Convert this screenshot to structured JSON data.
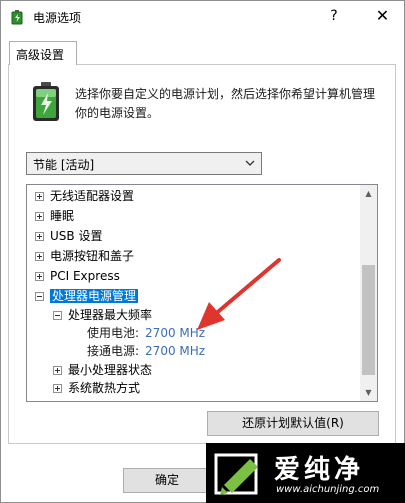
{
  "window": {
    "title": "电源选项",
    "help_glyph": "?",
    "close_glyph": "✕"
  },
  "tabs": [
    {
      "label": "高级设置",
      "active": true
    }
  ],
  "description": "选择你要自定义的电源计划，然后选择你希望计算机管理你的电源设置。",
  "plan_select": {
    "value": "节能 [活动]"
  },
  "tree": {
    "items": [
      {
        "label": "无线适配器设置",
        "expanded": false,
        "level": 0
      },
      {
        "label": "睡眠",
        "expanded": false,
        "level": 0
      },
      {
        "label": "USB 设置",
        "expanded": false,
        "level": 0
      },
      {
        "label": "电源按钮和盖子",
        "expanded": false,
        "level": 0
      },
      {
        "label": "PCI Express",
        "expanded": false,
        "level": 0
      },
      {
        "label": "处理器电源管理",
        "expanded": true,
        "level": 0,
        "selected": true
      },
      {
        "label": "处理器最大频率",
        "expanded": true,
        "level": 1
      },
      {
        "label": "最小处理器状态",
        "expanded": false,
        "level": 1
      },
      {
        "label": "系统散热方式",
        "expanded": false,
        "level": 1
      }
    ],
    "settings": [
      {
        "label": "使用电池:",
        "value": "2700 MHz"
      },
      {
        "label": "接通电源:",
        "value": "2700 MHz"
      }
    ],
    "scroll_position": 0.6
  },
  "buttons": {
    "restore_defaults": "还原计划默认值(R)",
    "ok": "确定"
  },
  "watermark": {
    "title": "爱纯净",
    "url": "www.aichunjing.com"
  },
  "colors": {
    "selection": "#0078d7",
    "value_text": "#3b6db5",
    "arrow": "#e0342e",
    "watermark_bg": "#000000"
  }
}
